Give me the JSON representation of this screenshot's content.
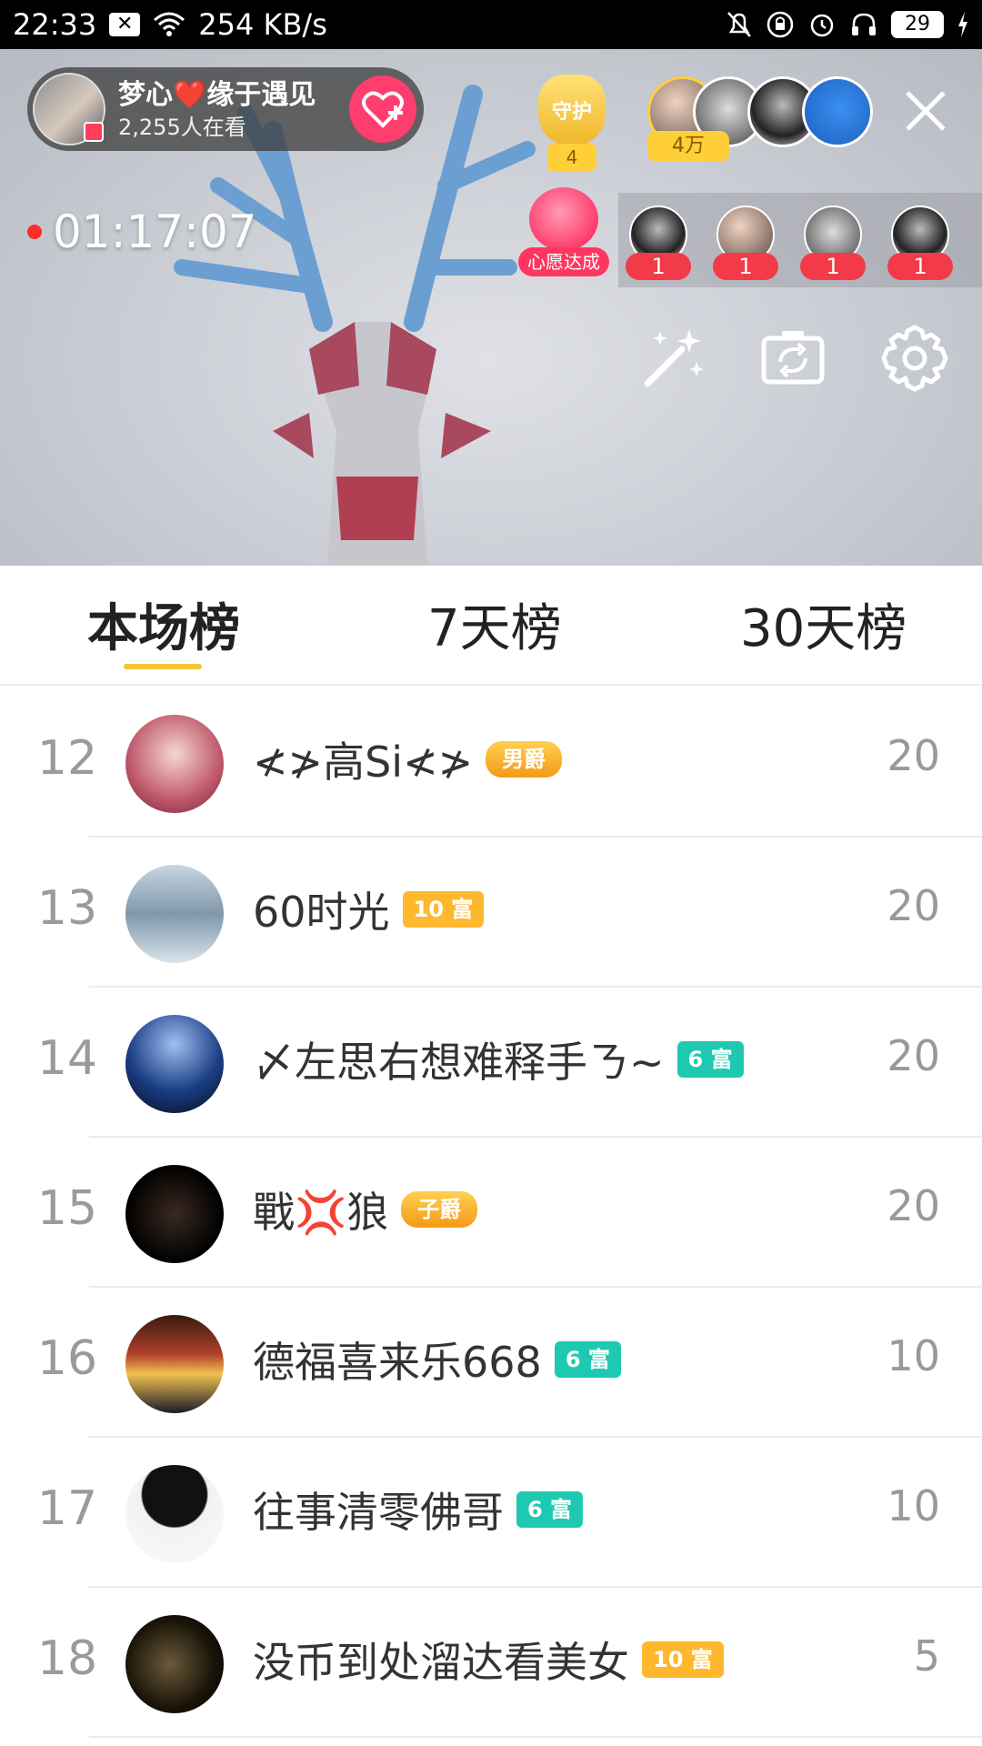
{
  "status_bar": {
    "time": "22:33",
    "notification_icon": "x-box-icon",
    "net_speed": "254 KB/s",
    "battery": "29"
  },
  "live": {
    "host": {
      "name": "梦心❤️缘于遇见",
      "viewers": "2,255人在看"
    },
    "guard": {
      "label": "守护",
      "count": "4"
    },
    "fan_count": "4万",
    "timer": "01:17:07",
    "wish_label": "心愿达成",
    "mic_seats": [
      {
        "num": "1"
      },
      {
        "num": "1"
      },
      {
        "num": "1"
      },
      {
        "num": "1"
      }
    ]
  },
  "tabs": [
    {
      "label": "本场榜",
      "active": true
    },
    {
      "label": "7天榜",
      "active": false
    },
    {
      "label": "30天榜",
      "active": false
    }
  ],
  "ranking": [
    {
      "rank": "12",
      "name": "≮≯高Si≮≯",
      "badge": "男爵",
      "badge_type": "title",
      "score": "20"
    },
    {
      "rank": "13",
      "name": "60时光",
      "badge": "10 富",
      "badge_type": "gold",
      "score": "20"
    },
    {
      "rank": "14",
      "name": "〆左思右想难释手ㄋ~",
      "badge": "6 富",
      "badge_type": "teal",
      "score": "20"
    },
    {
      "rank": "15",
      "name": "戰💢狼",
      "badge": "子爵",
      "badge_type": "title",
      "score": "20"
    },
    {
      "rank": "16",
      "name": "德福喜来乐668",
      "badge": "6 富",
      "badge_type": "teal",
      "score": "10"
    },
    {
      "rank": "17",
      "name": "往事清零佛哥",
      "badge": "6 富",
      "badge_type": "teal",
      "score": "10"
    },
    {
      "rank": "18",
      "name": "没币到处溜达看美女",
      "badge": "10 富",
      "badge_type": "gold",
      "score": "5"
    }
  ],
  "colors": {
    "accent_yellow": "#f6c636",
    "follow_pink": "#ff3d6e",
    "level_gold": "#ffb82e",
    "level_teal": "#1fc9b1"
  }
}
